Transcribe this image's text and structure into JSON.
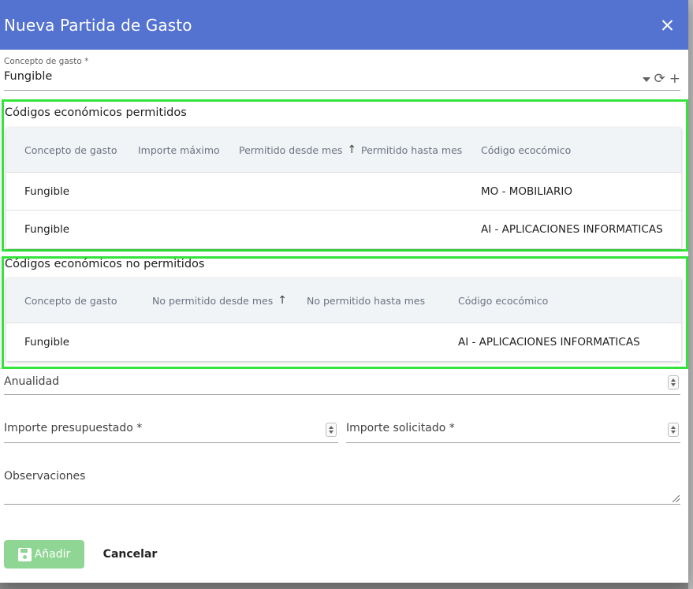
{
  "dialog": {
    "title": "Nueva Partida de Gasto"
  },
  "concepto": {
    "label": "Concepto de gasto *",
    "value": "Fungible"
  },
  "permitidos": {
    "title": "Códigos económicos permitidos",
    "headers": [
      "Concepto de gasto",
      "Importe máximo",
      "Permitido desde mes",
      "Permitido hasta mes",
      "Código ecocómico"
    ],
    "rows": [
      {
        "concepto": "Fungible",
        "importe": "",
        "desde": "",
        "hasta": "",
        "codigo": "MO - MOBILIARIO"
      },
      {
        "concepto": "Fungible",
        "importe": "",
        "desde": "",
        "hasta": "",
        "codigo": "AI - APLICACIONES INFORMATICAS"
      }
    ]
  },
  "no_permitidos": {
    "title": "Códigos económicos no permitidos",
    "headers": [
      "Concepto de gasto",
      "No permitido desde mes",
      "No permitido hasta mes",
      "Código ecocómico"
    ],
    "rows": [
      {
        "concepto": "Fungible",
        "desde": "",
        "hasta": "",
        "codigo": "AI - APLICACIONES INFORMATICAS"
      }
    ]
  },
  "anualidad": {
    "label": "Anualidad"
  },
  "importe_presupuestado": {
    "label": "Importe presupuestado *"
  },
  "importe_solicitado": {
    "label": "Importe solicitado *"
  },
  "observaciones": {
    "label": "Observaciones"
  },
  "buttons": {
    "add": "Añadir",
    "cancel": "Cancelar"
  }
}
